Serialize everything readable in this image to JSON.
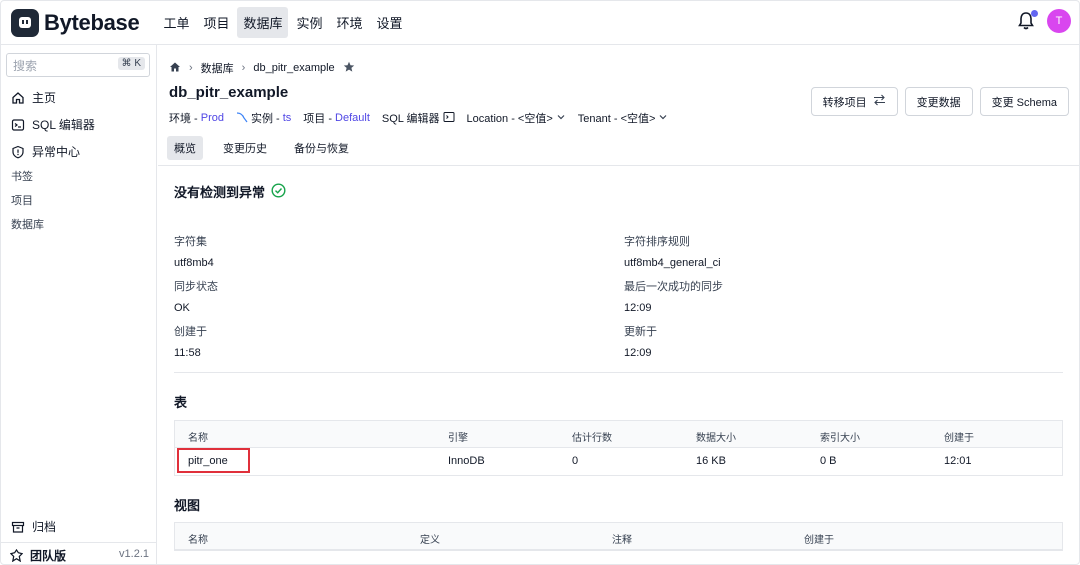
{
  "header": {
    "logo_text": "Bytebase",
    "nav": [
      "工单",
      "项目",
      "数据库",
      "实例",
      "环境",
      "设置"
    ],
    "active_nav": "数据库",
    "avatar_initial": "T",
    "colors": {
      "avatar": "#d946ef",
      "notification_dot": "#6366f1"
    }
  },
  "sidebar": {
    "search_placeholder": "搜索",
    "search_shortcut": "⌘ K",
    "items": [
      {
        "label": "主页",
        "icon": "home-icon"
      },
      {
        "label": "SQL 编辑器",
        "icon": "terminal-icon"
      },
      {
        "label": "异常中心",
        "icon": "shield-icon"
      }
    ],
    "sections": [
      "书签",
      "项目",
      "数据库"
    ],
    "archive_label": "归档",
    "plan_label": "团队版",
    "version": "v1.2.1"
  },
  "breadcrumb": {
    "section": "数据库",
    "current": "db_pitr_example"
  },
  "database": {
    "name": "db_pitr_example",
    "env_label": "环境 - ",
    "env_value": "Prod",
    "instance_label": "实例 - ",
    "instance_value": "ts",
    "project_label": "项目 - ",
    "project_value": "Default",
    "sql_editor_label": "SQL 编辑器",
    "location_label": "Location - <空值>",
    "tenant_label": "Tenant - <空值>"
  },
  "actions": {
    "transfer": "转移项目",
    "change_data": "变更数据",
    "change_schema": "变更 Schema"
  },
  "tabs": [
    "概览",
    "变更历史",
    "备份与恢复"
  ],
  "overview": {
    "anomaly_text": "没有检测到异常",
    "fields": {
      "charset_label": "字符集",
      "charset_value": "utf8mb4",
      "collation_label": "字符排序规则",
      "collation_value": "utf8mb4_general_ci",
      "sync_status_label": "同步状态",
      "sync_status_value": "OK",
      "last_sync_label": "最后一次成功的同步",
      "last_sync_value": "12:09",
      "created_label": "创建于",
      "created_value": "11:58",
      "updated_label": "更新于",
      "updated_value": "12:09"
    }
  },
  "tables": {
    "title": "表",
    "columns": [
      "名称",
      "引擎",
      "估计行数",
      "数据大小",
      "索引大小",
      "创建于"
    ],
    "rows": [
      {
        "name": "pitr_one",
        "engine": "InnoDB",
        "rows": "0",
        "data_size": "16 KB",
        "index_size": "0 B",
        "created": "12:01"
      }
    ],
    "highlight_color": "#e0303b"
  },
  "views": {
    "title": "视图",
    "columns": [
      "名称",
      "定义",
      "注释",
      "创建于"
    ]
  }
}
